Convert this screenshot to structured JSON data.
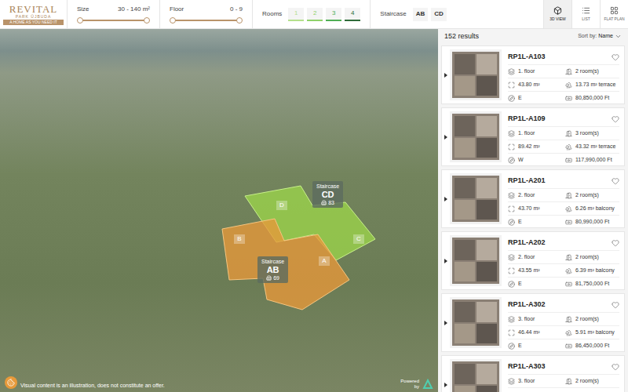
{
  "header": {
    "logo": {
      "name": "REVITAL",
      "subtitle": "PARK ÚJBUDA",
      "tagline": "A HOME AS YOU NEED IT"
    },
    "size": {
      "label": "Size",
      "value": "30 - 140 m²",
      "low": 0,
      "high": 1
    },
    "floor": {
      "label": "Floor",
      "value": "0 - 9",
      "low": 0,
      "high": 1
    },
    "rooms": {
      "label": "Rooms",
      "options": [
        {
          "label": "1",
          "color": "#b5e08c"
        },
        {
          "label": "2",
          "color": "#8fd16a"
        },
        {
          "label": "3",
          "color": "#4fae55"
        },
        {
          "label": "4",
          "color": "#2f6b3a"
        }
      ]
    },
    "staircase": {
      "label": "Staircase",
      "options": [
        {
          "label": "AB",
          "selected": false
        },
        {
          "label": "CD",
          "selected": false
        }
      ]
    },
    "views": [
      {
        "label": "3D VIEW",
        "selected": true
      },
      {
        "label": "LIST",
        "selected": false
      },
      {
        "label": "FLAT PLAN",
        "selected": false
      }
    ]
  },
  "map": {
    "buildings": [
      "D",
      "B",
      "C",
      "A"
    ],
    "staircases": [
      {
        "label": "Staircase",
        "name": "CD",
        "count": "83"
      },
      {
        "label": "Staircase",
        "name": "AB",
        "count": "69"
      }
    ],
    "disclaimer": "Visual content is an illustration, does not constitute an offer.",
    "powered_by": "Powered by"
  },
  "results": {
    "count": "152 results",
    "sort_label": "Sort by:",
    "sort_value": "Name",
    "flats": [
      {
        "code": "RP1L-A103",
        "floor": "1. floor",
        "rooms": "2 room(s)",
        "area": "43.80 m²",
        "outdoor": "13.73 m² terrace",
        "orientation": "E",
        "price": "80,850,000 Ft",
        "favorite": false
      },
      {
        "code": "RP1L-A109",
        "floor": "1. floor",
        "rooms": "3 room(s)",
        "area": "89.42 m²",
        "outdoor": "43.32 m² terrace",
        "orientation": "W",
        "price": "117,990,000 Ft",
        "favorite": false
      },
      {
        "code": "RP1L-A201",
        "floor": "2. floor",
        "rooms": "2 room(s)",
        "area": "43.70 m²",
        "outdoor": "6.26 m² balcony",
        "orientation": "E",
        "price": "80,990,000 Ft",
        "favorite": false
      },
      {
        "code": "RP1L-A202",
        "floor": "2. floor",
        "rooms": "2 room(s)",
        "area": "43.55 m²",
        "outdoor": "6.39 m² balcony",
        "orientation": "E",
        "price": "81,750,000 Ft",
        "favorite": false
      },
      {
        "code": "RP1L-A302",
        "floor": "3. floor",
        "rooms": "2 room(s)",
        "area": "46.44 m²",
        "outdoor": "5.91 m² balcony",
        "orientation": "E",
        "price": "86,450,000 Ft",
        "favorite": false
      },
      {
        "code": "RP1L-A303",
        "floor": "3. floor",
        "rooms": "2 room(s)",
        "favorite": false
      }
    ]
  }
}
